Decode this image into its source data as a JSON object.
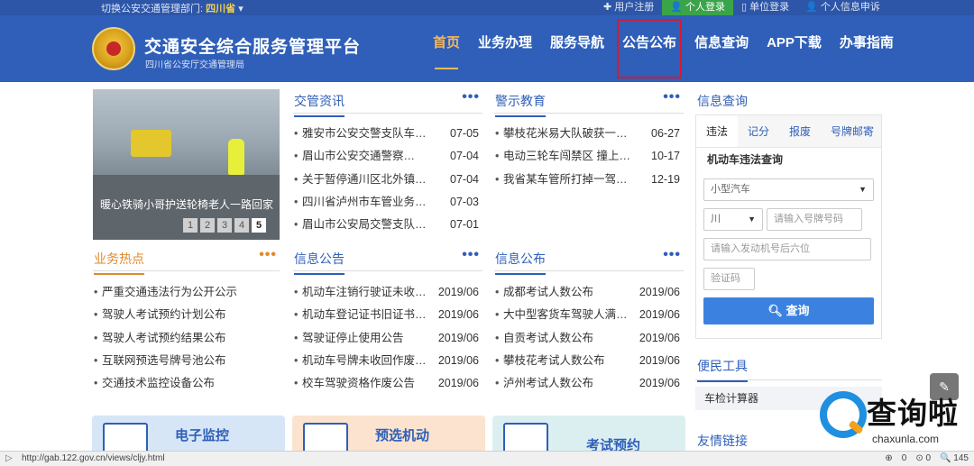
{
  "topbar": {
    "switch_label": "切换公安交通管理部门:",
    "province": "四川省",
    "links": [
      {
        "label": "✚ 用户注册",
        "active": false
      },
      {
        "label": "👤 个人登录",
        "active": true
      },
      {
        "label": "▯ 单位登录",
        "active": false
      },
      {
        "label": "👤 个人信息申诉",
        "active": false
      }
    ]
  },
  "header": {
    "title": "交通安全综合服务管理平台",
    "subtitle": "四川省公安厅交通管理局",
    "nav": [
      "首页",
      "业务办理",
      "服务导航",
      "公告公布",
      "信息查询",
      "APP下载",
      "办事指南"
    ]
  },
  "carousel": {
    "caption": "暖心铁骑小哥护送轮椅老人一路回家",
    "pages": [
      "1",
      "2",
      "3",
      "4",
      "5"
    ]
  },
  "sections": {
    "news": {
      "title": "交管资讯",
      "more": "•••",
      "items": [
        {
          "text": "雅安市公安交警支队车…",
          "date": "07-05"
        },
        {
          "text": "眉山市公安交通警察…",
          "date": "07-04"
        },
        {
          "text": "关于暂停通川区北外镇…",
          "date": "07-04"
        },
        {
          "text": "四川省泸州市车管业务…",
          "date": "07-03"
        },
        {
          "text": "眉山市公安局交警支队…",
          "date": "07-01"
        }
      ]
    },
    "warning": {
      "title": "警示教育",
      "more": "•••",
      "items": [
        {
          "text": "攀枝花米易大队破获一…",
          "date": "06-27"
        },
        {
          "text": "电动三轮车闯禁区 撞上…",
          "date": "10-17"
        },
        {
          "text": "我省某车管所打掉一驾…",
          "date": "12-19"
        }
      ]
    },
    "hot": {
      "title": "业务热点",
      "more": "•••",
      "items": [
        {
          "text": "严重交通违法行为公开公示"
        },
        {
          "text": "驾驶人考试预约计划公布"
        },
        {
          "text": "驾驶人考试预约结果公布"
        },
        {
          "text": "互联网预选号牌号池公布"
        },
        {
          "text": "交通技术监控设备公布"
        }
      ]
    },
    "notice": {
      "title": "信息公告",
      "more": "•••",
      "items": [
        {
          "text": "机动车注销行驶证未收…",
          "date": "2019/06"
        },
        {
          "text": "机动车登记证书旧证书…",
          "date": "2019/06"
        },
        {
          "text": "驾驶证停止使用公告",
          "date": "2019/06"
        },
        {
          "text": "机动车号牌未收回作废…",
          "date": "2019/06"
        },
        {
          "text": "校车驾驶资格作废公告",
          "date": "2019/06"
        }
      ]
    },
    "publish": {
      "title": "信息公布",
      "more": "•••",
      "items": [
        {
          "text": "成都考试人数公布",
          "date": "2019/06"
        },
        {
          "text": "大中型客货车驾驶人满…",
          "date": "2019/06"
        },
        {
          "text": "自贡考试人数公布",
          "date": "2019/06"
        },
        {
          "text": "攀枝花考试人数公布",
          "date": "2019/06"
        },
        {
          "text": "泸州考试人数公布",
          "date": "2019/06"
        }
      ]
    }
  },
  "query": {
    "title": "信息查询",
    "tabs": [
      "违法",
      "记分",
      "报废",
      "号牌邮寄"
    ],
    "subtitle": "机动车违法查询",
    "vehicle_type": "小型汽车",
    "province_abbr": "川",
    "plate_placeholder": "请输入号牌号码",
    "engine_placeholder": "请输入发动机号后六位",
    "captcha_placeholder": "验证码",
    "button": "查询"
  },
  "tools": {
    "title": "便民工具",
    "items": [
      "车检计算器"
    ]
  },
  "links_title": "友情链接",
  "cards": [
    {
      "label": "电子监控",
      "bg": "#d6e6f7"
    },
    {
      "label": "预选机动",
      "bg": "#fbe3cf"
    },
    {
      "label": "考试预约",
      "bg": "#dceff0"
    }
  ],
  "watermark": {
    "text": "查询啦",
    "domain": "chaxunla.com"
  },
  "status": {
    "url": "http://gab.122.gov.cn/views/cljy.html",
    "right": [
      "⊕",
      "0",
      "⊙ 0",
      "🔍 145"
    ]
  }
}
